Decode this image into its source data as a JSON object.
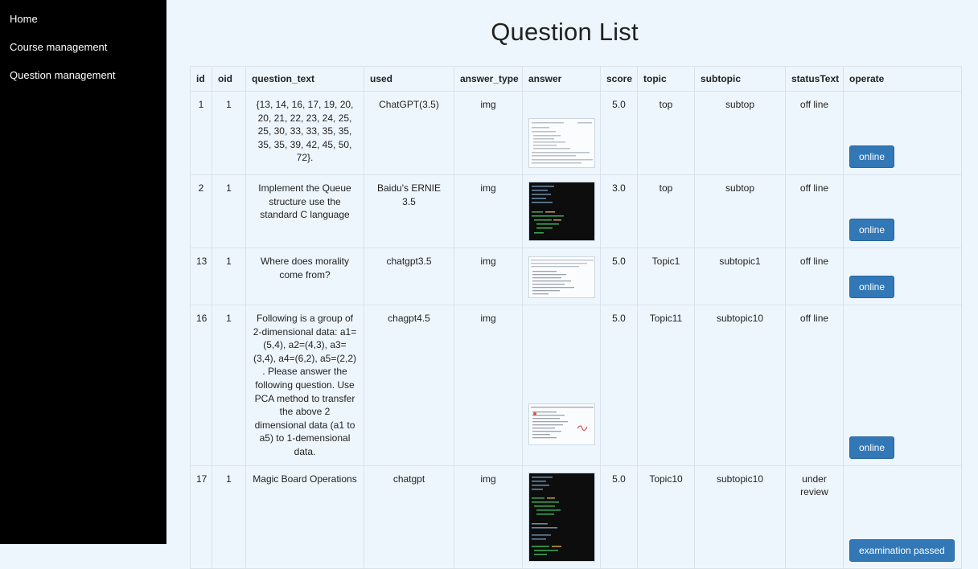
{
  "nav": {
    "items": [
      {
        "label": "Home"
      },
      {
        "label": "Course management"
      },
      {
        "label": "Question management"
      }
    ]
  },
  "main": {
    "title": "Question List",
    "columns": [
      "id",
      "oid",
      "question_text",
      "used",
      "answer_type",
      "answer",
      "score",
      "topic",
      "subtopic",
      "statusText",
      "operate"
    ],
    "rows": [
      {
        "id": "1",
        "oid": "1",
        "question_text": "{13, 14, 16, 17, 19, 20, 20, 21, 22, 23, 24, 25, 25, 30, 33, 33, 35, 35, 35, 35, 39, 42, 45, 50, 72}.",
        "used": "ChatGPT(3.5)",
        "answer_type": "img",
        "answer_image": "code-screenshot-light",
        "score": "5.0",
        "topic": "top",
        "subtopic": "subtop",
        "status": "off line",
        "operate": "online"
      },
      {
        "id": "2",
        "oid": "1",
        "question_text": "Implement the Queue structure use the standard C language",
        "used": "Baidu's ERNIE 3.5",
        "answer_type": "img",
        "answer_image": "code-screenshot-dark",
        "score": "3.0",
        "topic": "top",
        "subtopic": "subtop",
        "status": "off line",
        "operate": "online"
      },
      {
        "id": "13",
        "oid": "1",
        "question_text": "Where does morality come from?",
        "used": "chatgpt3.5",
        "answer_type": "img",
        "answer_image": "text-screenshot-light",
        "score": "5.0",
        "topic": "Topic1",
        "subtopic": "subtopic1",
        "status": "off line",
        "operate": "online"
      },
      {
        "id": "16",
        "oid": "1",
        "question_text": "Following is a group of 2-dimensional data: a1=(5,4), a2=(4,3), a3=(3,4), a4=(6,2), a5=(2,2) . Please answer the following question. Use PCA method to transfer the above 2 dimensional data (a1 to a5) to 1-demensional data.",
        "used": "chagpt4.5",
        "answer_type": "img",
        "answer_image": "graded-screenshot-light",
        "score": "5.0",
        "topic": "Topic11",
        "subtopic": "subtopic10",
        "status": "off line",
        "operate": "online"
      },
      {
        "id": "17",
        "oid": "1",
        "question_text": "Magic Board Operations",
        "used": "chatgpt",
        "answer_type": "img",
        "answer_image": "code-screenshot-dark-long",
        "score": "5.0",
        "topic": "Topic10",
        "subtopic": "subtopic10",
        "status": "under review",
        "operate": "examination passed"
      }
    ]
  }
}
